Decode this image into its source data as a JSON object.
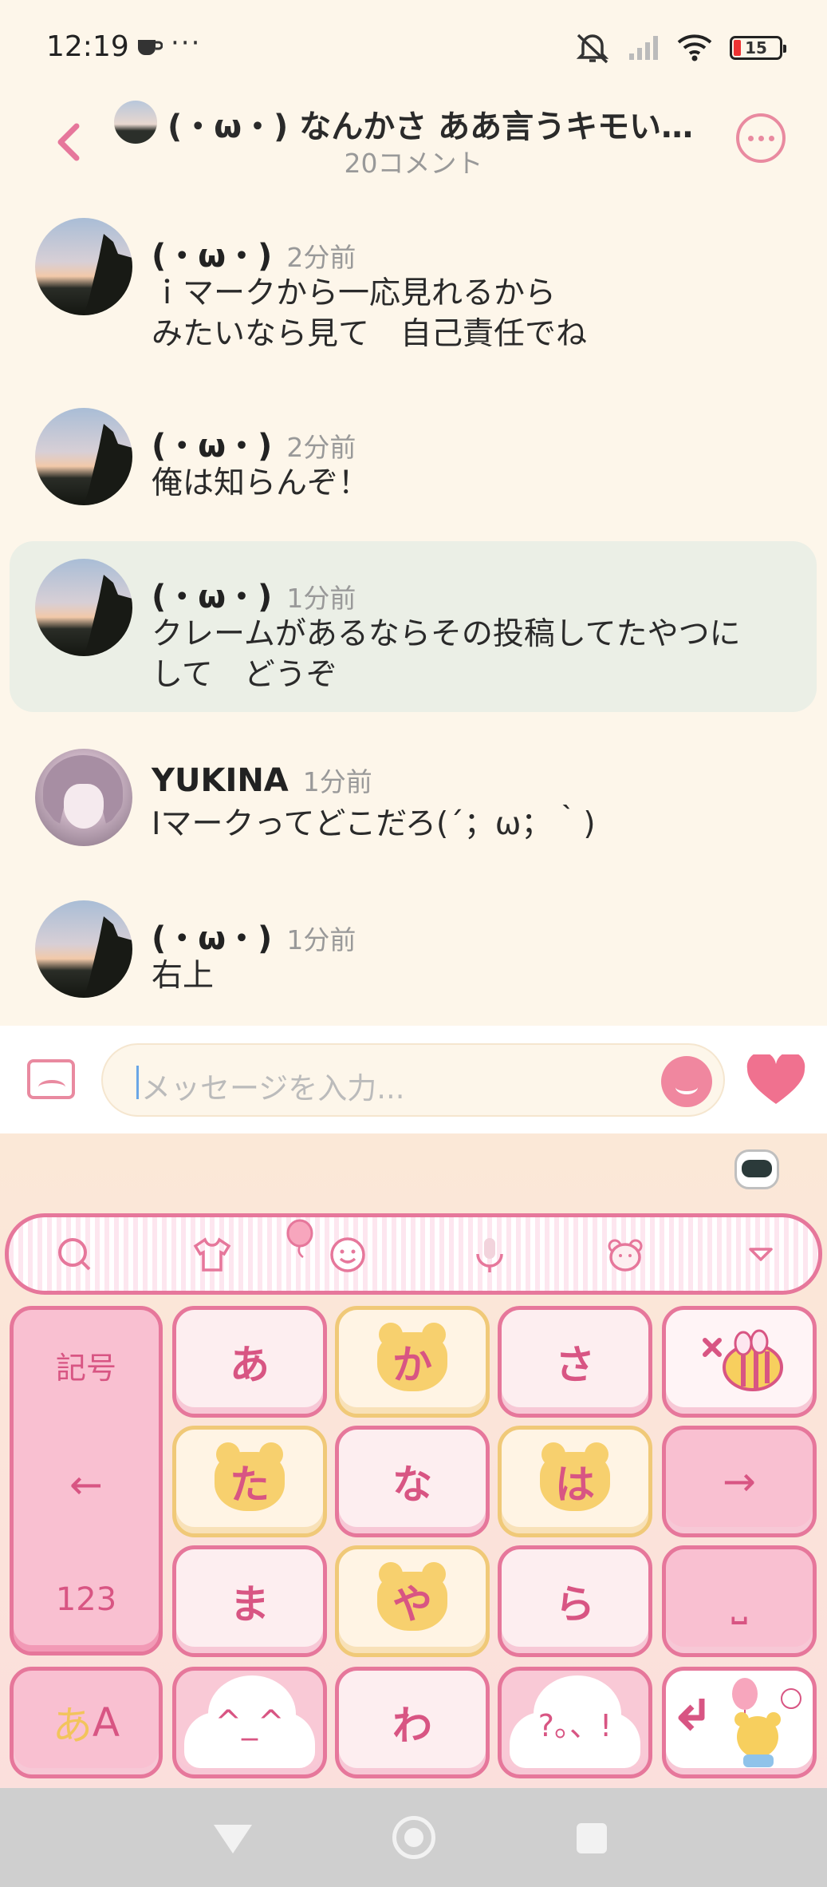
{
  "status": {
    "time": "12:19",
    "dots": "···",
    "battery": "15"
  },
  "header": {
    "title": "(・ω・) なんかさ ああ言うキモい…",
    "subtitle": "20コメント"
  },
  "comments": [
    {
      "name": "(・ω・)",
      "time": "2分前",
      "text": "ｉマークから一応見れるから\nみたいなら見て　自己責任でね"
    },
    {
      "name": "(・ω・)",
      "time": "2分前",
      "text": "俺は知らんぞ！"
    },
    {
      "name": "(・ω・)",
      "time": "1分前",
      "text": "クレームがあるならその投稿してたやつに\nして　どうぞ"
    },
    {
      "name": "YUKINA",
      "time": "1分前",
      "text": "Iマークってどこだろ(´；ω；｀)"
    },
    {
      "name": "(・ω・)",
      "time": "1分前",
      "text": "右上"
    }
  ],
  "input": {
    "placeholder": "メッセージを入力..."
  },
  "keyboard": {
    "side_top": "記号",
    "side_arrow_left": "←",
    "side_bottom": "123",
    "keys": [
      "あ",
      "か",
      "さ",
      "た",
      "な",
      "は",
      "ま",
      "や",
      "ら",
      "わ"
    ],
    "arrow_right": "→",
    "space": "⎵",
    "kana_toggle_a": "あ",
    "kana_toggle_b": "A",
    "smile_face": "^_^",
    "question_key": "?。、!"
  },
  "colors": {
    "accent": "#e6779b",
    "bg": "#fdf6ea",
    "highlight": "#ebefe6"
  }
}
